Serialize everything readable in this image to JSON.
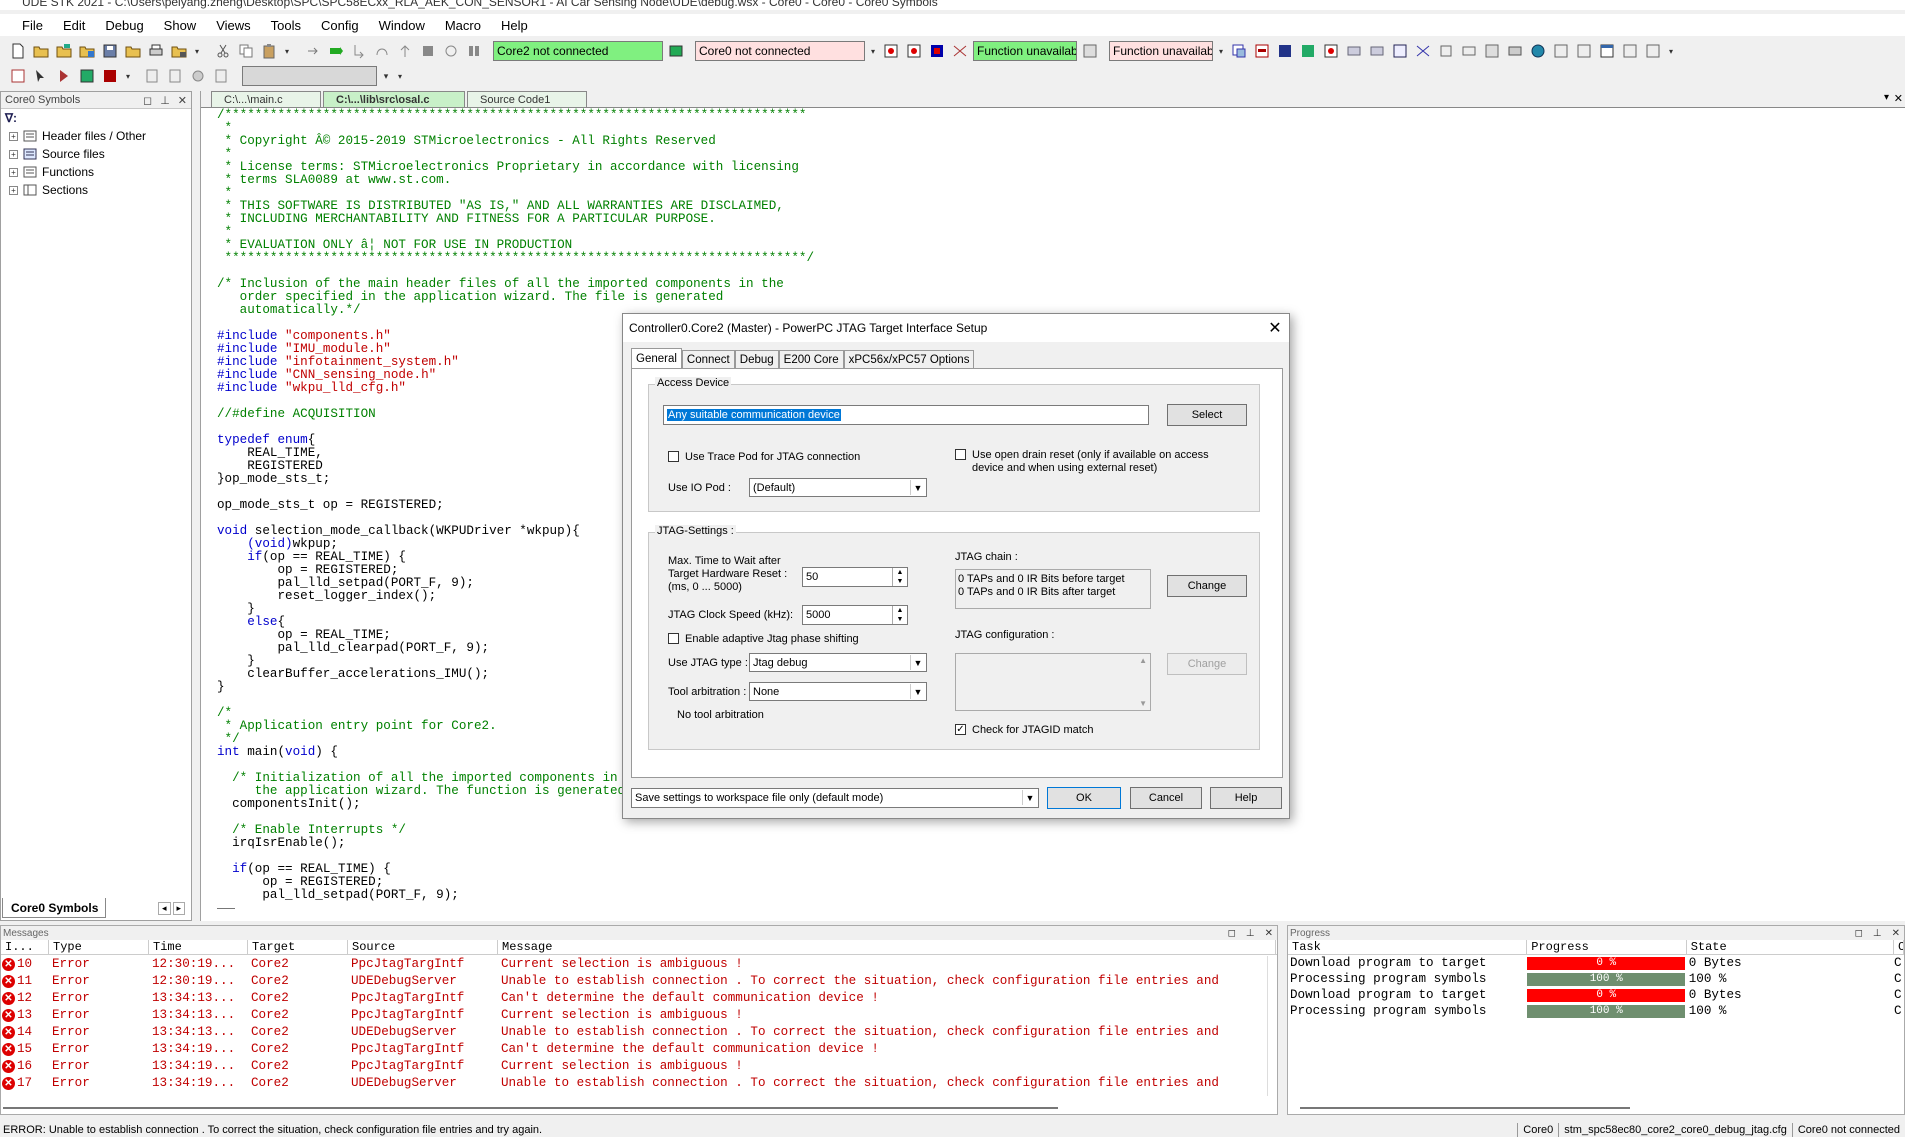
{
  "window": {
    "title": "UDE STK 2021 - C:\\Users\\peiyang.zheng\\Desktop\\SPC\\SPC58ECxx_RLA_AEK_CON_SENSOR1 - AI Car Sensing Node\\UDE\\debug.wsx - Core0 - Core0 - Core0 Symbols"
  },
  "menu": [
    "File",
    "Edit",
    "Debug",
    "Show",
    "Views",
    "Tools",
    "Config",
    "Window",
    "Macro",
    "Help"
  ],
  "toolbar": {
    "core2_status": "Core2 not connected",
    "core0_status": "Core0 not connected",
    "func1": "Function unavailabl",
    "func2": "Function unavailabl"
  },
  "left_panel": {
    "title": "Core0 Symbols",
    "tree": [
      "Header files / Other",
      "Source files",
      "Functions",
      "Sections"
    ],
    "bottom_tab": "Core0 Symbols"
  },
  "editor": {
    "tabs": [
      "C:\\...\\main.c",
      "C:\\...\\lib\\src\\osal.c",
      "Source Code1"
    ]
  },
  "code": [
    [
      [
        "cm",
        "/*****************************************************************************"
      ]
    ],
    [
      [
        "cm",
        " *"
      ]
    ],
    [
      [
        "cm",
        " * Copyright Â© 2015-2019 STMicroelectronics - All Rights Reserved"
      ]
    ],
    [
      [
        "cm",
        " *"
      ]
    ],
    [
      [
        "cm",
        " * License terms: STMicroelectronics Proprietary in accordance with licensing"
      ]
    ],
    [
      [
        "cm",
        " * terms SLA0089 at www.st.com."
      ]
    ],
    [
      [
        "cm",
        " *"
      ]
    ],
    [
      [
        "cm",
        " * THIS SOFTWARE IS DISTRIBUTED \"AS IS,\" AND ALL WARRANTIES ARE DISCLAIMED,"
      ]
    ],
    [
      [
        "cm",
        " * INCLUDING MERCHANTABILITY AND FITNESS FOR A PARTICULAR PURPOSE."
      ]
    ],
    [
      [
        "cm",
        " *"
      ]
    ],
    [
      [
        "cm",
        " * EVALUATION ONLY â¦ NOT FOR USE IN PRODUCTION"
      ]
    ],
    [
      [
        "cm",
        " *****************************************************************************/"
      ]
    ],
    [
      [
        "nr",
        ""
      ]
    ],
    [
      [
        "cm",
        "/* Inclusion of the main header files of all the imported components in the"
      ]
    ],
    [
      [
        "cm",
        "   order specified in the application wizard. The file is generated"
      ]
    ],
    [
      [
        "cm",
        "   automatically.*/"
      ]
    ],
    [
      [
        "nr",
        ""
      ]
    ],
    [
      [
        "kw",
        "#include "
      ],
      [
        "st",
        "\"components.h\""
      ]
    ],
    [
      [
        "kw",
        "#include "
      ],
      [
        "st",
        "\"IMU_module.h\""
      ]
    ],
    [
      [
        "kw",
        "#include "
      ],
      [
        "st",
        "\"infotainment_system.h\""
      ]
    ],
    [
      [
        "kw",
        "#include "
      ],
      [
        "st",
        "\"CNN_sensing_node.h\""
      ]
    ],
    [
      [
        "kw",
        "#include "
      ],
      [
        "st",
        "\"wkpu_lld_cfg.h\""
      ]
    ],
    [
      [
        "nr",
        ""
      ]
    ],
    [
      [
        "cm",
        "//#define ACQUISITION"
      ]
    ],
    [
      [
        "nr",
        ""
      ]
    ],
    [
      [
        "kw",
        "typedef enum"
      ],
      [
        "nr",
        "{"
      ]
    ],
    [
      [
        "nr",
        "    REAL_TIME,"
      ]
    ],
    [
      [
        "nr",
        "    REGISTERED"
      ]
    ],
    [
      [
        "nr",
        "}op_mode_sts_t;"
      ]
    ],
    [
      [
        "nr",
        ""
      ]
    ],
    [
      [
        "nr",
        "op_mode_sts_t op = REGISTERED;"
      ]
    ],
    [
      [
        "nr",
        ""
      ]
    ],
    [
      [
        "kw",
        "void"
      ],
      [
        "nr",
        " selection_mode_callback(WKPUDriver *wkpup){"
      ]
    ],
    [
      [
        "nr",
        "    "
      ],
      [
        "kw",
        "(void)"
      ],
      [
        "nr",
        "wkpup;"
      ]
    ],
    [
      [
        "nr",
        "    "
      ],
      [
        "kw",
        "if"
      ],
      [
        "nr",
        "(op == REAL_TIME) {"
      ]
    ],
    [
      [
        "nr",
        "        op = REGISTERED;"
      ]
    ],
    [
      [
        "nr",
        "        pal_lld_setpad(PORT_F, 9);"
      ]
    ],
    [
      [
        "nr",
        "        reset_logger_index();"
      ]
    ],
    [
      [
        "nr",
        "    }"
      ]
    ],
    [
      [
        "nr",
        "    "
      ],
      [
        "kw",
        "else"
      ],
      [
        "nr",
        "{"
      ]
    ],
    [
      [
        "nr",
        "        op = REAL_TIME;"
      ]
    ],
    [
      [
        "nr",
        "        pal_lld_clearpad(PORT_F, 9);"
      ]
    ],
    [
      [
        "nr",
        "    }"
      ]
    ],
    [
      [
        "nr",
        "    clearBuffer_accelerations_IMU();"
      ]
    ],
    [
      [
        "nr",
        "}"
      ]
    ],
    [
      [
        "nr",
        ""
      ]
    ],
    [
      [
        "cm",
        "/*"
      ]
    ],
    [
      [
        "cm",
        " * Application entry point for Core2."
      ]
    ],
    [
      [
        "cm",
        " */"
      ]
    ],
    [
      [
        "kw",
        "int"
      ],
      [
        "nr",
        " main("
      ],
      [
        "kw",
        "void"
      ],
      [
        "nr",
        ") {"
      ]
    ],
    [
      [
        "nr",
        ""
      ]
    ],
    [
      [
        "nr",
        "  "
      ],
      [
        "cm",
        "/* Initialization of all the imported components in the order specified in"
      ]
    ],
    [
      [
        "cm",
        "     the application wizard. The function is generated automatically.*/"
      ]
    ],
    [
      [
        "nr",
        "  componentsInit();"
      ]
    ],
    [
      [
        "nr",
        ""
      ]
    ],
    [
      [
        "nr",
        "  "
      ],
      [
        "cm",
        "/* Enable Interrupts */"
      ]
    ],
    [
      [
        "nr",
        "  irqIsrEnable();"
      ]
    ],
    [
      [
        "nr",
        ""
      ]
    ],
    [
      [
        "nr",
        "  "
      ],
      [
        "kw",
        "if"
      ],
      [
        "nr",
        "(op == REAL_TIME) {"
      ]
    ],
    [
      [
        "nr",
        "      op = REGISTERED;"
      ]
    ],
    [
      [
        "nr",
        "      pal_lld_setpad(PORT_F, 9);"
      ]
    ]
  ],
  "dialog": {
    "title": "Controller0.Core2 (Master) - PowerPC JTAG Target Interface Setup",
    "tabs": [
      "General",
      "Connect",
      "Debug",
      "E200 Core",
      "xPC56x/xPC57 Options"
    ],
    "access_device": {
      "group": "Access Device",
      "value": "Any suitable communication device",
      "select_btn": "Select",
      "trace_pod": "Use Trace Pod for JTAG connection",
      "open_drain": "Use open drain reset (only if available on access device and when using external reset)",
      "io_pod_label": "Use IO Pod :",
      "io_pod_value": "(Default)"
    },
    "jtag": {
      "group": "JTAG-Settings :",
      "max_time_label": "Max. Time to Wait after Target Hardware Reset : (ms, 0 ... 5000)",
      "max_time_value": "50",
      "clock_label": "JTAG Clock Speed (kHz):",
      "clock_value": "5000",
      "adaptive": "Enable adaptive Jtag phase shifting",
      "type_label": "Use JTAG type :",
      "type_value": "Jtag debug",
      "arb_label": "Tool arbitration :",
      "arb_value": "None",
      "no_arb": "No tool arbitration",
      "chain_label": "JTAG chain :",
      "chain_line1": "0 TAPs and 0 IR Bits before target",
      "chain_line2": "0 TAPs and 0 IR Bits after target",
      "change_btn": "Change",
      "config_label": "JTAG configuration :",
      "change2_btn": "Change",
      "check_id": "Check for JTAGID match"
    },
    "save_mode": "Save settings to workspace file only (default mode)",
    "ok": "OK",
    "cancel": "Cancel",
    "help": "Help"
  },
  "messages": {
    "title": "Messages",
    "headers": [
      "I...",
      "Type",
      "Time",
      "Target",
      "Source",
      "Message"
    ],
    "rows": [
      {
        "id": "10",
        "type": "Error",
        "time": "12:30:19...",
        "target": "Core2",
        "source": "PpcJtagTargIntf",
        "msg": "Current selection is ambiguous !"
      },
      {
        "id": "11",
        "type": "Error",
        "time": "12:30:19...",
        "target": "Core2",
        "source": "UDEDebugServer",
        "msg": "Unable to establish connection . To correct the situation, check configuration file entries and"
      },
      {
        "id": "12",
        "type": "Error",
        "time": "13:34:13...",
        "target": "Core2",
        "source": "PpcJtagTargIntf",
        "msg": "Can't determine the default communication device !"
      },
      {
        "id": "13",
        "type": "Error",
        "time": "13:34:13...",
        "target": "Core2",
        "source": "PpcJtagTargIntf",
        "msg": "Current selection is ambiguous !"
      },
      {
        "id": "14",
        "type": "Error",
        "time": "13:34:13...",
        "target": "Core2",
        "source": "UDEDebugServer",
        "msg": "Unable to establish connection . To correct the situation, check configuration file entries and"
      },
      {
        "id": "15",
        "type": "Error",
        "time": "13:34:19...",
        "target": "Core2",
        "source": "PpcJtagTargIntf",
        "msg": "Can't determine the default communication device !"
      },
      {
        "id": "16",
        "type": "Error",
        "time": "13:34:19...",
        "target": "Core2",
        "source": "PpcJtagTargIntf",
        "msg": "Current selection is ambiguous !"
      },
      {
        "id": "17",
        "type": "Error",
        "time": "13:34:19...",
        "target": "Core2",
        "source": "UDEDebugServer",
        "msg": "Unable to establish connection . To correct the situation, check configuration file entries and"
      }
    ]
  },
  "progress": {
    "title": "Progress",
    "headers": [
      "Task",
      "Progress",
      "State",
      "C"
    ],
    "rows": [
      {
        "task": "Download program to target",
        "progress": "0 %",
        "fraction": 0,
        "color": "#ff0000",
        "state": "0 Bytes"
      },
      {
        "task": "Processing program symbols",
        "progress": "100 %",
        "fraction": 1,
        "color": "#6f8f6f",
        "state": "100 %"
      },
      {
        "task": "Download program to target",
        "progress": "0 %",
        "fraction": 0,
        "color": "#ff0000",
        "state": "0 Bytes"
      },
      {
        "task": "Processing program symbols",
        "progress": "100 %",
        "fraction": 1,
        "color": "#6f8f6f",
        "state": "100 %"
      }
    ]
  },
  "status": {
    "text": "ERROR: Unable to establish connection . To correct the situation, check configuration file entries and try again.",
    "core": "Core0",
    "cfg": "stm_spc58ec80_core2_core0_debug_jtag.cfg",
    "conn": "Core0 not connected"
  }
}
